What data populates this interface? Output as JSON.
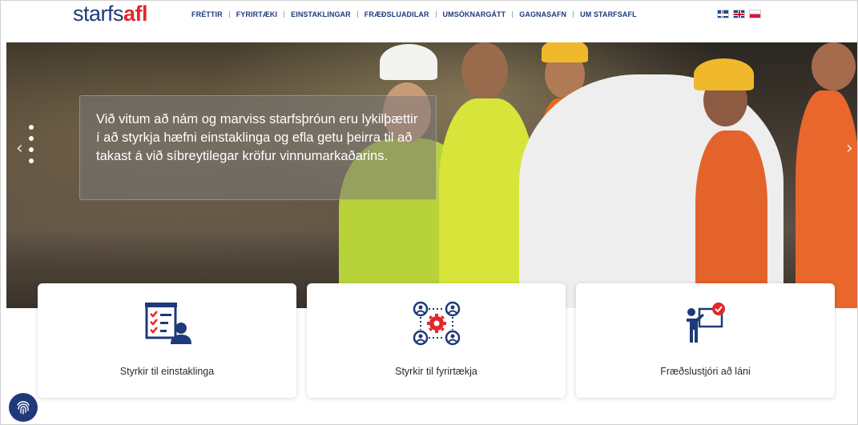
{
  "header": {
    "logo_part1": "starfs",
    "logo_part2": "afl",
    "nav": [
      "FRÉTTIR",
      "FYRIRTÆKI",
      "EINSTAKLINGAR",
      "FRÆÐSLUADILAR",
      "UMSÓKNARGÁTT",
      "GAGNASAFN",
      "UM STARFSAFL"
    ],
    "flags": [
      "iceland-flag-icon",
      "uk-flag-icon",
      "poland-flag-icon"
    ]
  },
  "hero": {
    "caption": "Við vitum að nám og marviss starfsþróun eru lykilþættir í að styrkja hæfni einstaklinga og efla getu þeirra til að takast á við síbreytilegar kröfur vinnumarkaðarins.",
    "prev_icon": "‹",
    "next_icon": "›"
  },
  "cards": [
    {
      "label": "Styrkir til einstaklinga",
      "icon": "checklist-person-icon"
    },
    {
      "label": "Styrkir til fyrirtækja",
      "icon": "team-gear-icon"
    },
    {
      "label": "Fræðslustjóri að láni",
      "icon": "presenter-board-icon"
    }
  ],
  "colors": {
    "brand_blue": "#1f3a7a",
    "brand_red": "#e3262a"
  },
  "floating": {
    "icon": "fingerprint-icon"
  }
}
